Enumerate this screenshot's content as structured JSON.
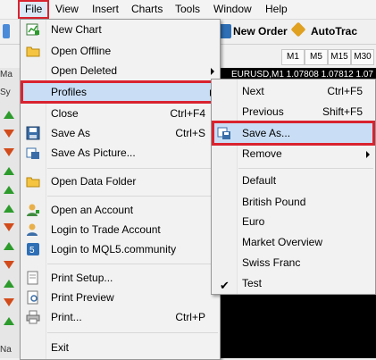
{
  "menubar": [
    "File",
    "View",
    "Insert",
    "Charts",
    "Tools",
    "Window",
    "Help"
  ],
  "toolbar": {
    "new_order": "New Order",
    "autotrading": "AutoTrac"
  },
  "timeframes": [
    "M1",
    "M5",
    "M15",
    "M30"
  ],
  "left_panel": {
    "tab_top": "Ma",
    "tab_sym": "Sy",
    "tab_bottom": "Na"
  },
  "chart": {
    "title": "EURUSD,M1  1.07808 1.07812 1.07"
  },
  "file_menu": {
    "items": [
      {
        "label": "New Chart",
        "shortcut": "",
        "icon": "new-chart-icon"
      },
      {
        "label": "Open Offline",
        "shortcut": "",
        "icon": "folder-icon"
      },
      {
        "label": "Open Deleted",
        "shortcut": "",
        "submenu": true
      },
      {
        "label": "Profiles",
        "shortcut": "",
        "submenu": true
      },
      {
        "label": "Close",
        "shortcut": "Ctrl+F4"
      },
      {
        "label": "Save As",
        "shortcut": "Ctrl+S",
        "icon": "save-icon"
      },
      {
        "label": "Save As Picture...",
        "shortcut": "",
        "icon": "save-picture-icon"
      },
      {
        "label": "Open Data Folder",
        "shortcut": "",
        "icon": "folder-icon"
      },
      {
        "label": "Open an Account",
        "shortcut": "",
        "icon": "account-icon"
      },
      {
        "label": "Login to Trade Account",
        "shortcut": "",
        "icon": "login-icon"
      },
      {
        "label": "Login to MQL5.community",
        "shortcut": "",
        "icon": "mql5-icon"
      },
      {
        "label": "Print Setup...",
        "shortcut": "",
        "icon": "print-setup-icon"
      },
      {
        "label": "Print Preview",
        "shortcut": "",
        "icon": "print-preview-icon"
      },
      {
        "label": "Print...",
        "shortcut": "Ctrl+P",
        "icon": "printer-icon"
      },
      {
        "label": "Exit",
        "shortcut": ""
      }
    ]
  },
  "profiles_menu": {
    "items": [
      {
        "label": "Next",
        "shortcut": "Ctrl+F5"
      },
      {
        "label": "Previous",
        "shortcut": "Shift+F5"
      },
      {
        "label": "Save As...",
        "shortcut": "",
        "icon": "save-profile-icon"
      },
      {
        "label": "Remove",
        "shortcut": "",
        "submenu": true
      },
      {
        "label": "Default"
      },
      {
        "label": "British Pound"
      },
      {
        "label": "Euro"
      },
      {
        "label": "Market Overview"
      },
      {
        "label": "Swiss Franc"
      },
      {
        "label": "Test",
        "checked": true
      }
    ]
  },
  "colors": {
    "highlight_red": "#d9232f",
    "highlight_blue": "#c9def5",
    "up_arrow": "#2c9b2c",
    "down_arrow": "#d24b1a"
  }
}
